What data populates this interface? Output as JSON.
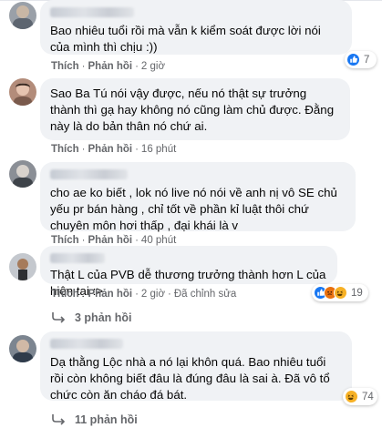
{
  "comments": [
    {
      "text": "Bao nhiêu tuổi rồi mà vẫn k kiểm soát được lời nói của mình thì chịu :))",
      "like_label": "Thích",
      "reply_label": "Phản hồi",
      "time": "2 giờ",
      "reaction_count": "7"
    },
    {
      "text": "Sao Ba Tú nói vậy được, nếu nó thật sự trưởng thành thì gạ hay không nó cũng làm chủ được. Đằng này là do bản thân nó chứ ai.",
      "like_label": "Thích",
      "reply_label": "Phản hồi",
      "time": "16 phút"
    },
    {
      "text": "cho ae ko biết , lok nó live nó nói về anh nị vô SE chủ yếu pr bán hàng , chỉ tốt về phần kỉ luật thôi chứ chuyên môn hơi thấp , đại khái là v",
      "like_label": "Thích",
      "reply_label": "Phản hồi",
      "time": "40 phút"
    },
    {
      "text": "Thật L của PVB dễ thương trưởng thành hơn L của hiện tại :>",
      "like_label": "Thích",
      "reply_label": "Phản hồi",
      "time": "2 giờ",
      "edited": "Đã chỉnh sửa",
      "reaction_count": "19",
      "replies": "3 phản hồi"
    },
    {
      "text": "Dạ thằng Lộc nhà a nó lại khôn quá. Bao nhiêu tuổi rồi còn không biết đâu là đúng đâu là sai à. Đã vô tổ chức còn ăn cháo đá bát.",
      "reaction_count": "74",
      "replies": "11 phản hồi"
    }
  ],
  "colors": {
    "bubble": "#f0f2f5",
    "meta_text": "#65676b",
    "like_blue": "#1877f2",
    "haha_yellow": "#f7b125",
    "angry_orange": "#e9710f"
  }
}
